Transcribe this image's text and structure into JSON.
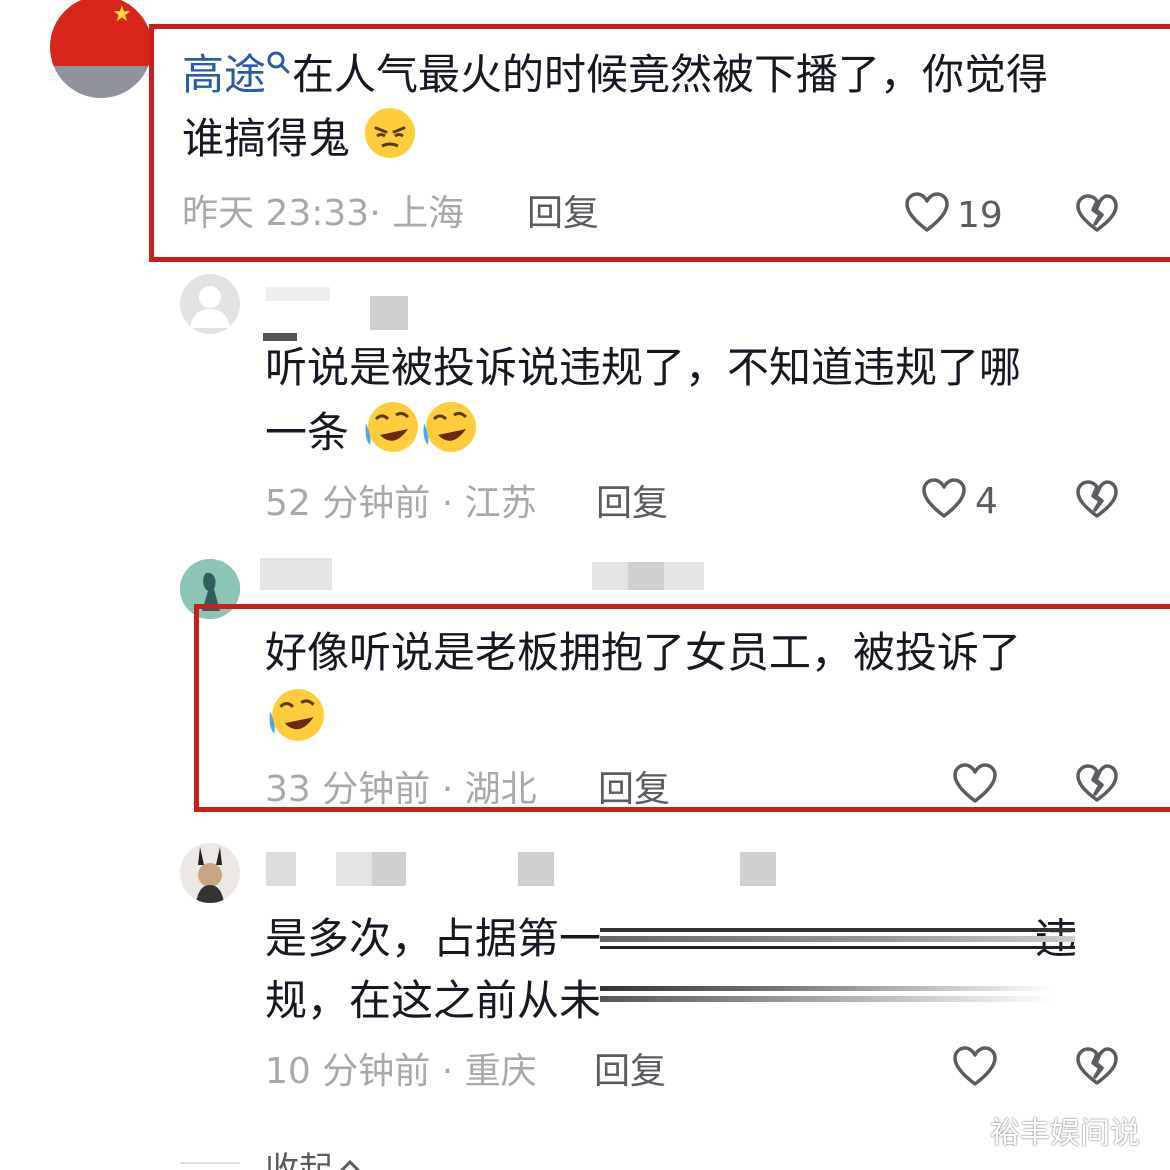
{
  "comments": [
    {
      "mention": "高途",
      "line1": "在人气最火的时候竟然被下播了，你觉得",
      "line2": "谁搞得鬼",
      "time": "昨天 23:33",
      "location": "上海",
      "reply": "回复",
      "likes": "19"
    },
    {
      "line1": "听说是被投诉说违规了，不知道违规了哪",
      "line2": "一条",
      "time": "52 分钟前",
      "location": "江苏",
      "reply": "回复",
      "likes": "4"
    },
    {
      "line1": "好像听说是老板拥抱了女员工，被投诉了",
      "time": "33 分钟前",
      "location": "湖北",
      "reply": "回复"
    },
    {
      "line1_start": "是多次，占据第一",
      "line1_end": "违",
      "line2": "规，在这之前从未",
      "time": "10 分钟前",
      "location": "重庆",
      "reply": "回复"
    }
  ],
  "separator": "·",
  "collapse": "收起",
  "watermark": "裕丰娱间说",
  "icons": {
    "search": "search-icon",
    "like": "heart-icon",
    "dislike": "broken-heart-icon",
    "collapse": "chevron-up-icon"
  },
  "colors": {
    "highlight_box": "#c8211d",
    "mention": "#2b5aa6",
    "meta": "#a8a9ad"
  }
}
